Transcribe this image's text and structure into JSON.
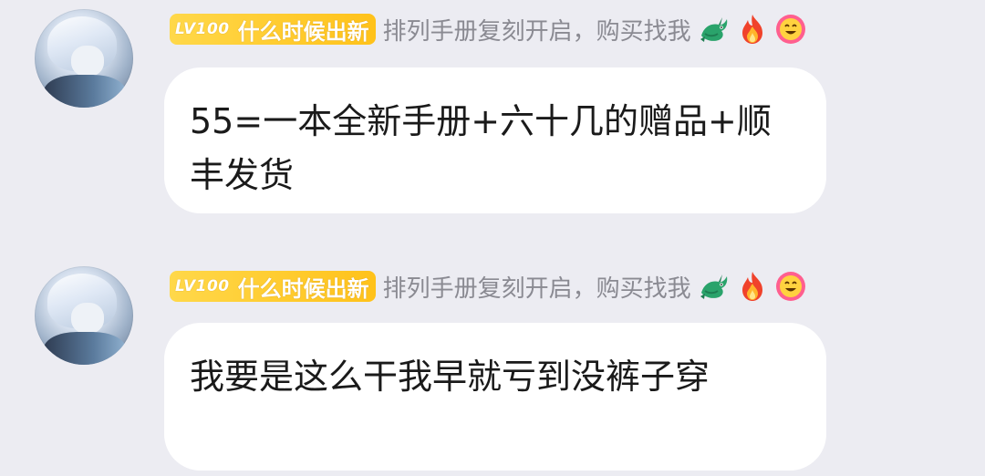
{
  "messages": [
    {
      "badge": {
        "level": "LV100",
        "title": "什么时候出新"
      },
      "nickname": "排列手册复刻开启，购买找我",
      "text": "55=一本全新手册+六十几的赠品+顺丰发货"
    },
    {
      "badge": {
        "level": "LV100",
        "title": "什么时候出新"
      },
      "nickname": "排列手册复刻开启，购买找我",
      "text": "我要是这么干我早就亏到没裤子穿"
    }
  ],
  "icons": [
    "avatar",
    "dragon-icon",
    "fire-icon",
    "smile-icon"
  ],
  "colors": {
    "background": "#ececf2",
    "bubble": "#ffffff",
    "badge": "#ffc21a",
    "nickname": "#8a8a92"
  }
}
